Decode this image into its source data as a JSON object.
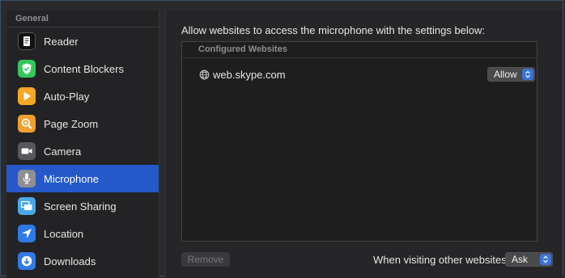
{
  "sidebar": {
    "section_title": "General",
    "items": [
      {
        "label": "Reader",
        "icon": "reader-icon",
        "color": "#1c1c1e"
      },
      {
        "label": "Content Blockers",
        "icon": "content-blockers-icon",
        "color": "#34c759"
      },
      {
        "label": "Auto-Play",
        "icon": "auto-play-icon",
        "color": "#f5a623"
      },
      {
        "label": "Page Zoom",
        "icon": "page-zoom-icon",
        "color": "#f0a030"
      },
      {
        "label": "Camera",
        "icon": "camera-icon",
        "color": "#58585c"
      },
      {
        "label": "Microphone",
        "icon": "microphone-icon",
        "color": "#8e8e93"
      },
      {
        "label": "Screen Sharing",
        "icon": "screen-sharing-icon",
        "color": "#4aa8ea"
      },
      {
        "label": "Location",
        "icon": "location-icon",
        "color": "#2f7ae5"
      },
      {
        "label": "Downloads",
        "icon": "downloads-icon",
        "color": "#2f7ae5"
      }
    ],
    "selected": "Microphone",
    "selected_color": "#2559c9"
  },
  "main": {
    "intro": "Allow websites to access the microphone with the settings below:",
    "configured_header": "Configured Websites",
    "sites": [
      {
        "name": "web.skype.com",
        "permission": "Allow"
      }
    ],
    "remove_label": "Remove",
    "other_label": "When visiting other websites:",
    "other_value": "Ask"
  }
}
